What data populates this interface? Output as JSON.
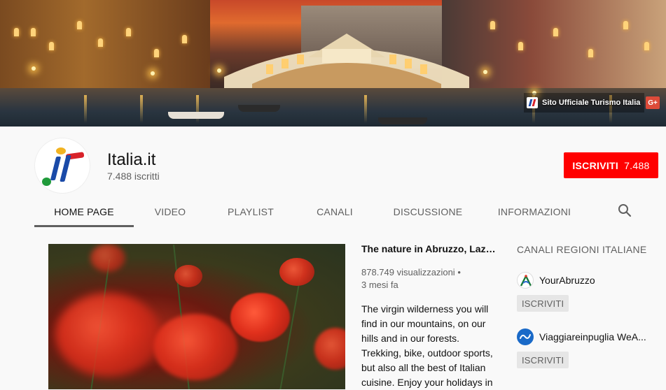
{
  "banner": {
    "link_text": "Sito Ufficiale Turismo Italia",
    "gplus_label": "G+"
  },
  "channel": {
    "name": "Italia.it",
    "subscribers": "7.488 iscritti",
    "subscribe_label": "ISCRIVITI",
    "subscribe_count": "7.488"
  },
  "tabs": [
    {
      "label": "HOME PAGE",
      "active": true
    },
    {
      "label": "VIDEO",
      "active": false
    },
    {
      "label": "PLAYLIST",
      "active": false
    },
    {
      "label": "CANALI",
      "active": false
    },
    {
      "label": "DISCUSSIONE",
      "active": false
    },
    {
      "label": "INFORMAZIONI",
      "active": false
    }
  ],
  "featured_video": {
    "title": "The nature in Abruzzo, Lazio,...",
    "views": "878.749 visualizzazioni",
    "separator": "•",
    "age": "3 mesi fa",
    "description": "The virgin wilderness you will find in our mountains, on our hills and in our forests. Trekking, bike, outdoor sports, but also all the best of Italian cuisine. Enjoy your holidays in"
  },
  "sidebar": {
    "title": "CANALI REGIONI ITALIANE",
    "channels": [
      {
        "name": "YourAbruzzo",
        "subscribe_label": "ISCRIVITI",
        "icon": "your-abruzzo-logo"
      },
      {
        "name": "Viaggiareinpuglia WeA...",
        "subscribe_label": "ISCRIVITI",
        "icon": "viaggiareinpuglia-logo"
      }
    ]
  },
  "colors": {
    "subscribe_red": "#ff0000",
    "text_primary": "#111111",
    "text_secondary": "#606060"
  }
}
